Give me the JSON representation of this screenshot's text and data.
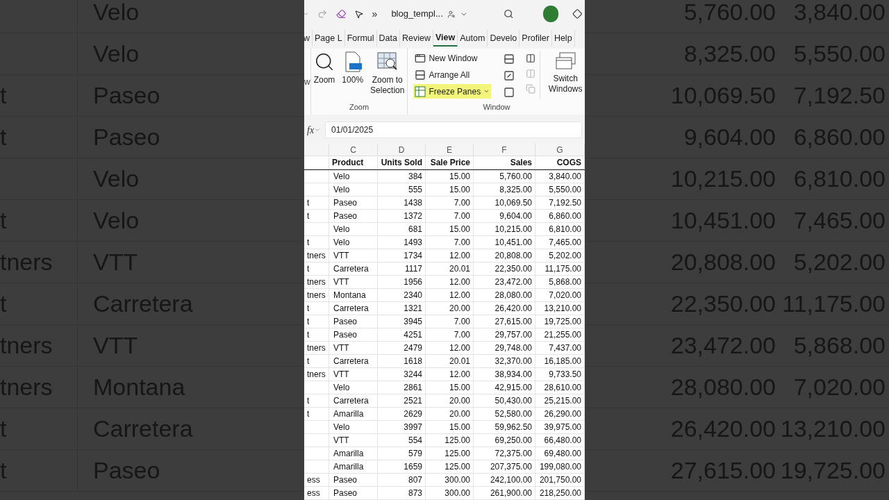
{
  "backdrop_left": [
    {
      "product": "Velo"
    },
    {
      "product": "Velo"
    },
    {
      "segment": "t",
      "product": "Paseo"
    },
    {
      "segment": "t",
      "product": "Paseo"
    },
    {
      "product": "Velo"
    },
    {
      "segment": "t",
      "product": "Velo"
    },
    {
      "segment": "tners",
      "product": "VTT"
    },
    {
      "segment": "t",
      "product": "Carretera"
    },
    {
      "segment": "tners",
      "product": "VTT"
    },
    {
      "segment": "tners",
      "product": "Montana"
    },
    {
      "segment": "t",
      "product": "Carretera"
    },
    {
      "segment": "t",
      "product": "Paseo"
    }
  ],
  "backdrop_right": [
    {
      "sales": "5,760.00",
      "cogs": "3,840.00"
    },
    {
      "sales": "8,325.00",
      "cogs": "5,550.00"
    },
    {
      "sales": "10,069.50",
      "cogs": "7,192.50"
    },
    {
      "sales": "9,604.00",
      "cogs": "6,860.00"
    },
    {
      "sales": "10,215.00",
      "cogs": "6,810.00"
    },
    {
      "sales": "10,451.00",
      "cogs": "7,465.00"
    },
    {
      "sales": "20,808.00",
      "cogs": "5,202.00"
    },
    {
      "sales": "22,350.00",
      "cogs": "11,175.00"
    },
    {
      "sales": "23,472.00",
      "cogs": "5,868.00"
    },
    {
      "sales": "28,080.00",
      "cogs": "7,020.00"
    },
    {
      "sales": "26,420.00",
      "cogs": "13,210.00"
    },
    {
      "sales": "27,615.00",
      "cogs": "19,725.00"
    }
  ],
  "title_bar": {
    "overflow": "»",
    "title": "blog_templ..."
  },
  "tabs": [
    {
      "label": "w",
      "selected": false
    },
    {
      "label": "Page L",
      "selected": false
    },
    {
      "label": "Formul",
      "selected": false
    },
    {
      "label": "Data",
      "selected": false
    },
    {
      "label": "Review",
      "selected": false
    },
    {
      "label": "View",
      "selected": true
    },
    {
      "label": "Autom",
      "selected": false
    },
    {
      "label": "Develo",
      "selected": false
    },
    {
      "label": "Profiler",
      "selected": false
    },
    {
      "label": "Help",
      "selected": false
    }
  ],
  "ribbon": {
    "cut_label": "w",
    "zoom_group": {
      "label": "Zoom",
      "buttons": [
        "Zoom",
        "100%",
        "Zoom to Selection"
      ]
    },
    "window_group": {
      "label": "Window",
      "buttons": [
        {
          "label": "New Window",
          "highlighted": false
        },
        {
          "label": "Arrange All",
          "highlighted": false
        },
        {
          "label": "Freeze Panes",
          "highlighted": true
        }
      ],
      "switch": "Switch Windows"
    }
  },
  "formula_bar": {
    "function_label": "fx",
    "value": "01/01/2025"
  },
  "sheet": {
    "column_letters": [
      "C",
      "D",
      "E",
      "F",
      "G"
    ],
    "header": [
      "Product",
      "Units Sold",
      "Sale Price",
      "Sales",
      "COGS"
    ],
    "rows": [
      {
        "product": "Velo",
        "units": "384",
        "price": "15.00",
        "sales": "5,760.00",
        "cogs": "3,840.00"
      },
      {
        "product": "Velo",
        "units": "555",
        "price": "15.00",
        "sales": "8,325.00",
        "cogs": "5,550.00"
      },
      {
        "segment": "t",
        "product": "Paseo",
        "units": "1438",
        "price": "7.00",
        "sales": "10,069.50",
        "cogs": "7,192.50"
      },
      {
        "segment": "t",
        "product": "Paseo",
        "units": "1372",
        "price": "7.00",
        "sales": "9,604.00",
        "cogs": "6,860.00"
      },
      {
        "product": "Velo",
        "units": "681",
        "price": "15.00",
        "sales": "10,215.00",
        "cogs": "6,810.00"
      },
      {
        "segment": "t",
        "product": "Velo",
        "units": "1493",
        "price": "7.00",
        "sales": "10,451.00",
        "cogs": "7,465.00"
      },
      {
        "segment": "tners",
        "product": "VTT",
        "units": "1734",
        "price": "12.00",
        "sales": "20,808.00",
        "cogs": "5,202.00"
      },
      {
        "segment": "t",
        "product": "Carretera",
        "units": "1117",
        "price": "20.01",
        "sales": "22,350.00",
        "cogs": "11,175.00"
      },
      {
        "segment": "tners",
        "product": "VTT",
        "units": "1956",
        "price": "12.00",
        "sales": "23,472.00",
        "cogs": "5,868.00"
      },
      {
        "segment": "tners",
        "product": "Montana",
        "units": "2340",
        "price": "12.00",
        "sales": "28,080.00",
        "cogs": "7,020.00"
      },
      {
        "segment": "t",
        "product": "Carretera",
        "units": "1321",
        "price": "20.00",
        "sales": "26,420.00",
        "cogs": "13,210.00"
      },
      {
        "segment": "t",
        "product": "Paseo",
        "units": "3945",
        "price": "7.00",
        "sales": "27,615.00",
        "cogs": "19,725.00"
      },
      {
        "segment": "t",
        "product": "Paseo",
        "units": "4251",
        "price": "7.00",
        "sales": "29,757.00",
        "cogs": "21,255.00"
      },
      {
        "segment": "tners",
        "product": "VTT",
        "units": "2479",
        "price": "12.00",
        "sales": "29,748.00",
        "cogs": "7,437.00"
      },
      {
        "segment": "t",
        "product": "Carretera",
        "units": "1618",
        "price": "20.01",
        "sales": "32,370.00",
        "cogs": "16,185.00"
      },
      {
        "segment": "tners",
        "product": "VTT",
        "units": "3244",
        "price": "12.00",
        "sales": "38,934.00",
        "cogs": "9,733.50"
      },
      {
        "product": "Velo",
        "units": "2861",
        "price": "15.00",
        "sales": "42,915.00",
        "cogs": "28,610.00"
      },
      {
        "segment": "t",
        "product": "Carretera",
        "units": "2521",
        "price": "20.00",
        "sales": "50,430.00",
        "cogs": "25,215.00"
      },
      {
        "segment": "t",
        "product": "Amarilla",
        "units": "2629",
        "price": "20.00",
        "sales": "52,580.00",
        "cogs": "26,290.00"
      },
      {
        "product": "Velo",
        "units": "3997",
        "price": "15.00",
        "sales": "59,962.50",
        "cogs": "39,975.00"
      },
      {
        "product": "VTT",
        "units": "554",
        "price": "125.00",
        "sales": "69,250.00",
        "cogs": "66,480.00"
      },
      {
        "product": "Amarilla",
        "units": "579",
        "price": "125.00",
        "sales": "72,375.00",
        "cogs": "69,480.00"
      },
      {
        "product": "Amarilla",
        "units": "1659",
        "price": "125.00",
        "sales": "207,375.00",
        "cogs": "199,080.00"
      },
      {
        "segment": "ess",
        "product": "Paseo",
        "units": "807",
        "price": "300.00",
        "sales": "242,100.00",
        "cogs": "201,750.00"
      },
      {
        "segment": "ess",
        "product": "Paseo",
        "units": "873",
        "price": "300.00",
        "sales": "261,900.00",
        "cogs": "218,250.00"
      }
    ]
  }
}
